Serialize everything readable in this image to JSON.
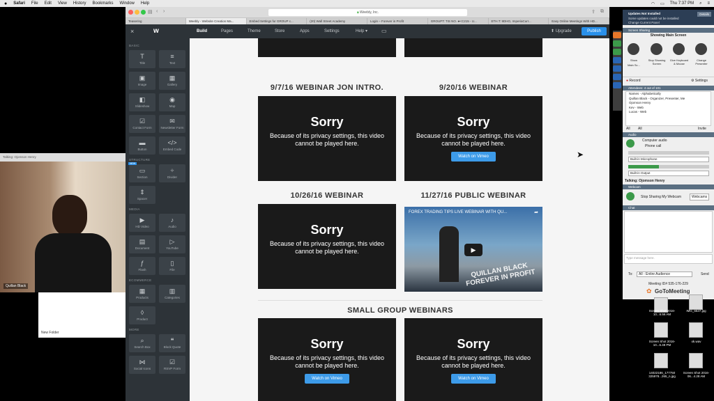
{
  "menubar": {
    "apple": "",
    "items": [
      "Safari",
      "File",
      "Edit",
      "View",
      "History",
      "Bookmarks",
      "Window",
      "Help"
    ],
    "clock": "Thu 7:37 PM"
  },
  "safari": {
    "url": "Weebly, Inc.",
    "tabs": [
      "Teasering",
      "Weebly - Website Creation Ma...",
      "Embed Settings for GROUP c...",
      "(20) Wall Street Academy",
      "Login – Forever in Profit",
      "GROUPT: TIS NO. ●•:C215 - U...",
      "ETH.T: 9DHO, ImperiaCurr...",
      "Easy Online Meetings With HD..."
    ]
  },
  "weebly": {
    "nav": [
      "Build",
      "Pages",
      "Theme",
      "Store",
      "Apps",
      "Settings",
      "Help ▾"
    ],
    "upgrade": "Upgrade",
    "publish": "Publish",
    "sections": {
      "basic": "BASIC",
      "structure": "STRUCTURE",
      "media": "MEDIA",
      "ecommerce": "ECOMMERCE",
      "more": "MORE"
    },
    "elements": {
      "title": "Title",
      "text": "Text",
      "image": "Image",
      "gallery": "Gallery",
      "slideshow": "Slideshow",
      "map": "Map",
      "contact": "Contact Form",
      "newsletter": "Newsletter Form",
      "button": "Button",
      "embed": "Embed Code",
      "section": "Section",
      "divider": "Divider",
      "spacer": "Spacer",
      "hdvideo": "HD Video",
      "audio": "Audio",
      "document": "Document",
      "youtube": "YouTube",
      "flash": "Flash",
      "file": "File",
      "products": "Products",
      "categories": "Categories",
      "product": "Product",
      "search": "Search Box",
      "blockquote": "Block Quote",
      "social": "Social Icons",
      "rsvp": "RSVP Form"
    },
    "new_badge": "NEW"
  },
  "content": {
    "sections": [
      "9/7/16 WEBINAR JON INTRO.",
      "9/20/16 WEBINAR",
      "10/26/16 WEBINAR",
      "11/27/16 PUBLIC WEBINAR",
      "SMALL GROUP WEBINARS"
    ],
    "sorry": "Sorry",
    "privacy": "Because of its privacy settings, this video cannot be played here.",
    "vimeo": "Watch on Vimeo",
    "yt_title": "FOREX TRADING TIPS LIVE WEBINAR WITH QU...",
    "yt_overlay": "QUILLAN BLACK FOREVER IN PROFIT"
  },
  "webcam": {
    "caption": "Talking: Ojomson Henry",
    "name": "Quillan Black",
    "folder": "New Folder"
  },
  "gtm": {
    "notice": "Updates Not Installed",
    "details": "Details",
    "notice2": "Some updates could not be installed",
    "changing": "Change Current Panel",
    "screen_sharing": "Screen Sharing",
    "showing": "Showing Main Screen",
    "show": "Show",
    "show_sub": "Main Sc...",
    "stop": "Stop Showing Screen",
    "give": "Give Keyboard & Mouse",
    "change": "Change Presenter",
    "record": "Record",
    "settings": "Settings",
    "attendees_hdr": "Attendees: 4 out of 101",
    "names_hdr": "Names - Alphabetically",
    "attendees": [
      "Quillan Black - Organizer, Presenter, Me",
      "Ojomson Henry",
      "Kev - Web",
      "Lucas - Web"
    ],
    "all": "All",
    "invite": "Invite",
    "audio": "Audio",
    "computer_audio": "Computer audio",
    "phone_call": "Phone call",
    "mic": "Built-in Microphone",
    "output": "Built-in Output",
    "talking": "Talking: Ojomson Henry",
    "webcam": "Webcam",
    "stop_webcam": "Stop Sharing My Webcam",
    "webcams": "Webcams",
    "chat": "Chat",
    "chat_placeholder": "Type message here.",
    "to": "To:",
    "to_value": "All - Entire Audience",
    "send": "Send",
    "meeting_id": "Meeting ID# 535-176-229",
    "brand": "GoToMeeting"
  },
  "desktop": [
    "Screen Shot 2016-10...6.56 AM",
    "IMG_6537.jpg",
    "Screen Shot 2016-10...6.48 PM",
    "ok.wav",
    "14022186_177750 325978...265_n.jpg",
    "Screen Shot 2016-06...4.28 AM"
  ],
  "colors": {
    "weebly_dark": "#2d3338",
    "publish_blue": "#2990ea",
    "vimeo_blue": "#3d9be9",
    "gtm_header": "#5a6f82"
  }
}
